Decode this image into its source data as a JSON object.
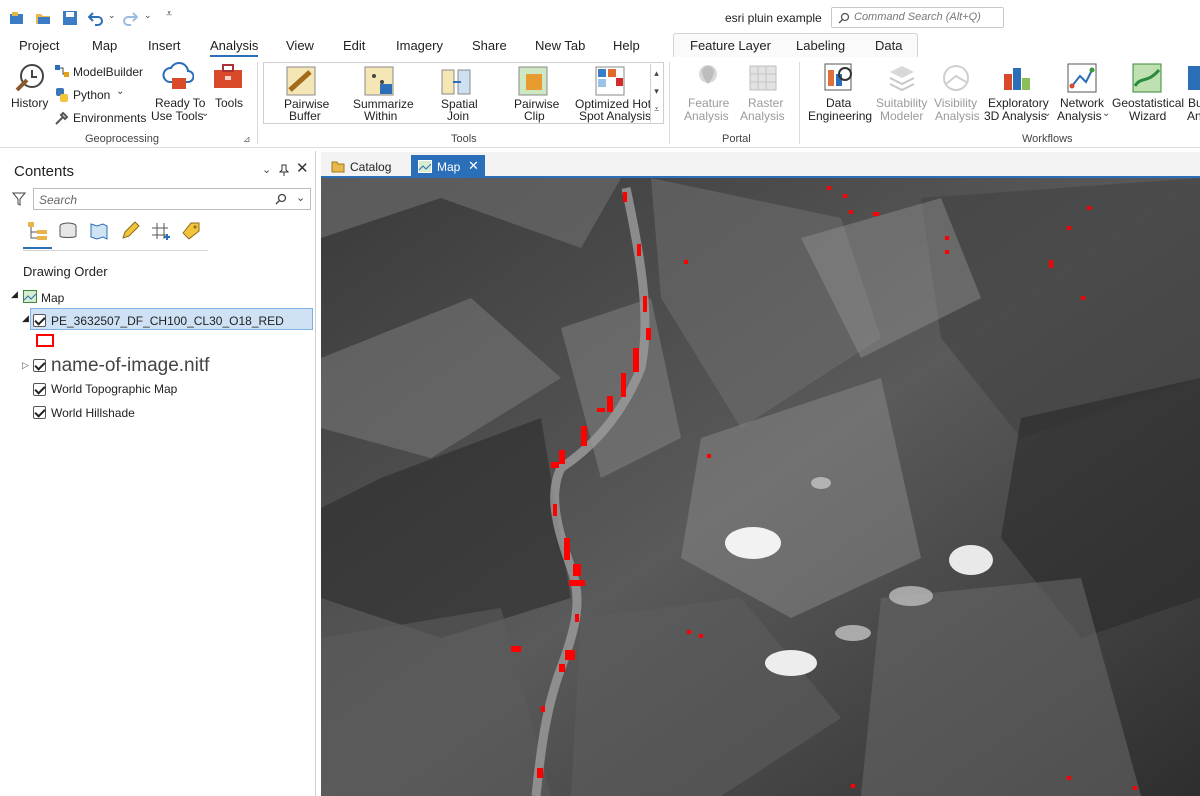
{
  "app": {
    "title": "esri pluin example"
  },
  "command_search": {
    "placeholder": "Command Search (Alt+Q)"
  },
  "ribbon_tabs": [
    "Project",
    "Map",
    "Insert",
    "Analysis",
    "View",
    "Edit",
    "Imagery",
    "Share",
    "New Tab",
    "Help"
  ],
  "active_tab": "Analysis",
  "contextual_tabs": [
    "Feature Layer",
    "Labeling",
    "Data"
  ],
  "geoprocessing": {
    "history": "History",
    "modelbuilder": "ModelBuilder",
    "python": "Python",
    "environments": "Environments",
    "ready_to_use_1": "Ready To",
    "ready_to_use_2": "Use Tools",
    "tools": "Tools",
    "group": "Geoprocessing"
  },
  "tools_gallery": {
    "items": [
      {
        "l1": "Pairwise",
        "l2": "Buffer"
      },
      {
        "l1": "Summarize",
        "l2": "Within"
      },
      {
        "l1": "Spatial",
        "l2": "Join"
      },
      {
        "l1": "Pairwise",
        "l2": "Clip"
      },
      {
        "l1": "Optimized Hot",
        "l2": "Spot Analysis"
      }
    ],
    "group": "Tools"
  },
  "portal": {
    "feature_1": "Feature",
    "feature_2": "Analysis",
    "raster_1": "Raster",
    "raster_2": "Analysis",
    "group": "Portal"
  },
  "workflows": {
    "items": [
      {
        "l1": "Data",
        "l2": "Engineering",
        "disabled": false
      },
      {
        "l1": "Suitability",
        "l2": "Modeler",
        "disabled": true
      },
      {
        "l1": "Visibility",
        "l2": "Analysis",
        "disabled": true
      },
      {
        "l1": "Exploratory",
        "l2": "3D Analysis",
        "disabled": false
      },
      {
        "l1": "Network",
        "l2": "Analysis",
        "disabled": false
      },
      {
        "l1": "Geostatistical",
        "l2": "Wizard",
        "disabled": false
      },
      {
        "l1": "Bu",
        "l2": "An",
        "disabled": false
      }
    ],
    "group": "Workflows"
  },
  "contents": {
    "title": "Contents",
    "search_placeholder": "Search",
    "drawing_order": "Drawing Order",
    "map_label": "Map",
    "layers": [
      {
        "name": "PE_3632507_DF_CH100_CL30_O18_RED"
      },
      {
        "name": "name-of-image.nitf"
      },
      {
        "name": "World Topographic Map"
      },
      {
        "name": "World Hillshade"
      }
    ]
  },
  "map_tabs": [
    {
      "label": "Catalog"
    },
    {
      "label": "Map"
    }
  ],
  "colors": {
    "accent": "#2b6fb8",
    "feature": "#ff0000"
  }
}
